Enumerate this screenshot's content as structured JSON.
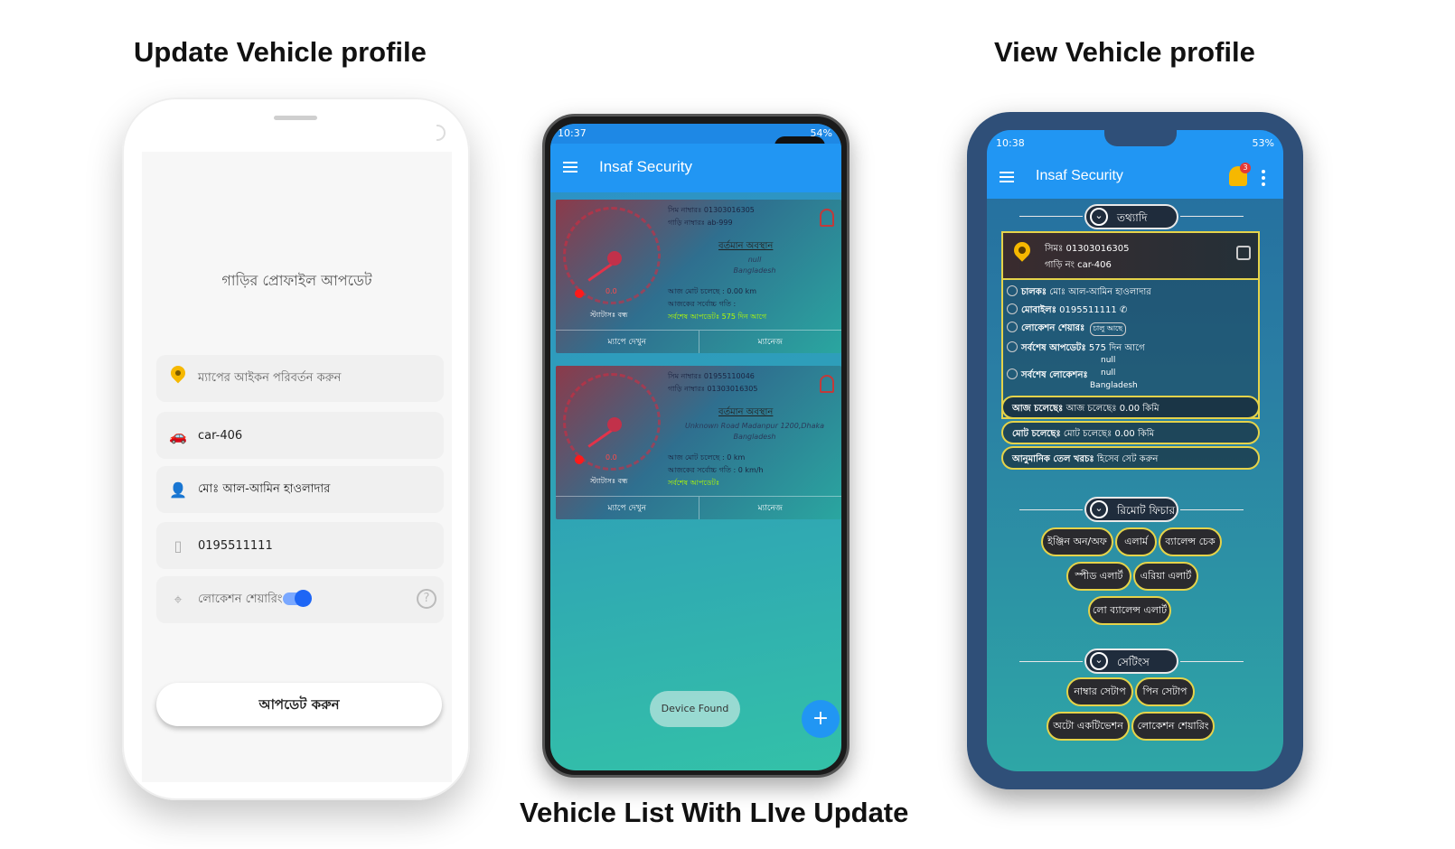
{
  "headings": {
    "left": "Update Vehicle profile",
    "right": "View Vehicle profile",
    "middle": "Vehicle List With LIve Update"
  },
  "left_phone": {
    "title": "গাড়ির প্রোফাইল আপডেট",
    "icon_change": {
      "icon": "map-pin-yellow",
      "placeholder": "ম্যাপের আইকন পরিবর্তন করুন"
    },
    "car_number": {
      "icon": "car-icon",
      "value": "car-406"
    },
    "driver_name": {
      "icon": "user-icon",
      "value": "মোঃ আল-আমিন হাওলাদার"
    },
    "mobile": {
      "icon": "phone-icon",
      "value": "0195511111"
    },
    "location_sharing": {
      "icon": "location-icon",
      "label": "লোকেশন শেয়ারিং",
      "enabled": true
    },
    "update_button": "আপডেট করুন"
  },
  "middle_phone": {
    "status_time": "10:37",
    "status_right": "54%",
    "app_title": "Insaf Security",
    "vehicles": [
      {
        "sim": "সিম নাম্বারঃ 01303016305",
        "car": "গাড়ি নাম্বারঃ ab-999",
        "current_location_title": "বর্তমান অবস্থান",
        "location_line1": "null",
        "location_line2": "Bangladesh",
        "today_distance": "আজ মোট চলেছে   :  0.00  km",
        "max_speed": "আজকের সর্বোচ্চ গতি :",
        "last_update": "সর্বশেষ আপডেটঃ 575 দিন আগে",
        "status": "স্ট্যাটাসঃ বন্ধ",
        "speed": "0.0",
        "action_map": "ম্যাপে দেখুন",
        "action_manage": "ম্যানেজ"
      },
      {
        "sim": "সিম নাম্বারঃ 01955110046",
        "car": "গাড়ি নাম্বারঃ 01303016305",
        "current_location_title": "বর্তমান অবস্থান",
        "location_line1": "Unknown Road Madanpur 1200,Dhaka",
        "location_line2": "Bangladesh",
        "today_distance": "আজ মোট চলেছে   :  0 km",
        "max_speed": "আজকের সর্বোচ্চ গতি :   0 km/h",
        "last_update": "সর্বশেষ আপডেটঃ",
        "status": "স্ট্যাটাসঃ বন্ধ",
        "speed": "0.0",
        "action_map": "ম্যাপে দেখুন",
        "action_manage": "ম্যানেজ"
      }
    ],
    "toast": "Device Found",
    "fab": "+"
  },
  "right_phone": {
    "status_time": "10:38",
    "status_right": "53%",
    "app_title": "Insaf Security",
    "notification_count": "3",
    "sections": {
      "info": "তথ্যাদি",
      "remote": "রিমোট ফিচার",
      "settings": "সেটিংস"
    },
    "info": {
      "sim": "সিমঃ 01303016305",
      "car": "গাড়ি নং  car-406",
      "driver_label": "চালকঃ",
      "driver_value": "মোঃ আল-আমিন হাওলাদার",
      "mobile_label": "মোবাইলঃ",
      "mobile_value": "0195511111",
      "location_share_label": "লোকেশন শেয়ারঃ",
      "location_share_value": "চালু আছে",
      "last_update_label": "সর্বশেষ আপডেটঃ",
      "last_update_value": "575 দিন আগে",
      "last_location_label": "সর্বশেষ লোকেশনঃ",
      "last_location_l1": "null",
      "last_location_l2": "null",
      "last_location_l3": "Bangladesh"
    },
    "summary": [
      {
        "label": "আজ চলেছেঃ",
        "value": "আজ চলেছেঃ 0.00  কিমি"
      },
      {
        "label": "মোট চলেছেঃ",
        "value": "মোট চলেছেঃ 0.00 কিমি"
      },
      {
        "label": "আনুমানিক তেল খরচঃ",
        "value": "হিসেব সেট করুন"
      }
    ],
    "remote_features": [
      "ইঞ্জিন অন/অফ",
      "এলার্ম",
      "ব্যালেন্স চেক",
      "স্পীড এলার্ট",
      "এরিয়া এলার্ট",
      "লো ব্যালেন্স এলার্ট"
    ],
    "settings": [
      "নাম্বার সেটাপ",
      "পিন সেটাপ",
      "অটো একটিভেশন",
      "লোকেশন শেয়ারিং"
    ]
  }
}
